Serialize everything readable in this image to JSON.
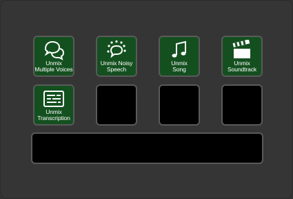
{
  "buttons": [
    {
      "line1": "Unmix",
      "line2": "Multiple Voices",
      "icon": "speech-bubbles-icon"
    },
    {
      "line1": "Unmix Noisy",
      "line2": "Speech",
      "icon": "noisy-speech-bubble-icon"
    },
    {
      "line1": "Unmix",
      "line2": "Song",
      "icon": "music-note-icon"
    },
    {
      "line1": "Unmix",
      "line2": "Soundtrack",
      "icon": "clapperboard-icon"
    },
    {
      "line1": "Unmix",
      "line2": "Transcription",
      "icon": "transcript-icon"
    }
  ],
  "colors": {
    "button_green": "#14501f",
    "background": "#343434",
    "empty_key": "#000000",
    "key_border": "#5a5a5a"
  }
}
